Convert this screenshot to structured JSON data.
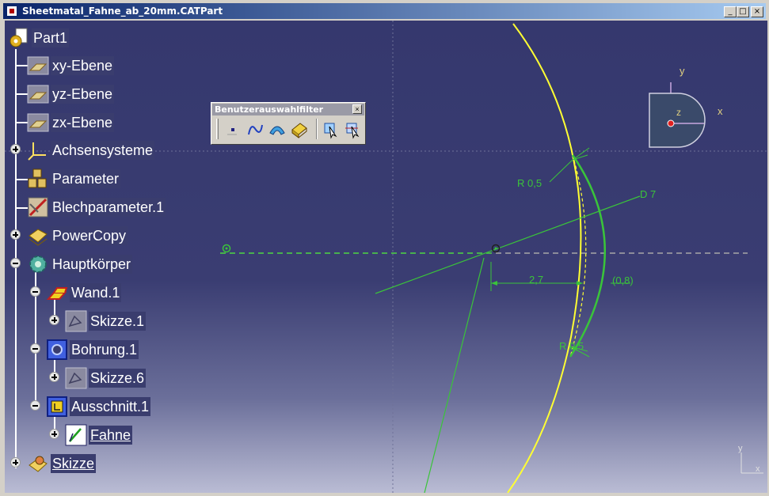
{
  "window": {
    "title": "Sheetmatal_Fahne_ab_20mm.CATPart",
    "buttons": {
      "minimize": "_",
      "maximize": "□",
      "close": "×"
    }
  },
  "tree": {
    "root": "Part1",
    "items": [
      {
        "label": "xy-Ebene",
        "icon": "plane-icon"
      },
      {
        "label": "yz-Ebene",
        "icon": "plane-icon"
      },
      {
        "label": "zx-Ebene",
        "icon": "plane-icon"
      },
      {
        "label": "Achsensysteme",
        "icon": "axis-system-icon",
        "expand": "plus"
      },
      {
        "label": "Parameter",
        "icon": "parameter-icon"
      },
      {
        "label": "Blechparameter.1",
        "icon": "sheetmetal-parameter-icon"
      },
      {
        "label": "PowerCopy",
        "icon": "powercopy-icon",
        "expand": "plus"
      },
      {
        "label": "Hauptkörper",
        "icon": "part-body-icon",
        "expand": "minus"
      },
      {
        "label": "Wand.1",
        "icon": "wall-icon",
        "expand": "minus"
      },
      {
        "label": "Skizze.1",
        "icon": "sketch-icon",
        "expand": "plus"
      },
      {
        "label": "Bohrung.1",
        "icon": "hole-icon",
        "expand": "minus"
      },
      {
        "label": "Skizze.6",
        "icon": "sketch-icon",
        "expand": "plus"
      },
      {
        "label": "Ausschnitt.1",
        "icon": "cutout-icon",
        "expand": "minus"
      },
      {
        "label": "Fahne",
        "icon": "active-sketch-icon",
        "expand": "plus",
        "underline": true
      },
      {
        "label": "Skizze",
        "icon": "sketch-body-icon",
        "expand": "plus",
        "underline": true
      }
    ]
  },
  "toolbar": {
    "title": "Benutzerauswahlfilter",
    "close": "×",
    "buttons": [
      "point-filter-icon",
      "curve-filter-icon",
      "surface-filter-icon",
      "volume-filter-icon",
      "feature-element-filter-icon",
      "intersection-edge-filter-icon"
    ]
  },
  "sketch": {
    "dimensions": {
      "r_top": "R 0,5",
      "diameter": "D 7",
      "horizontal": "2,7",
      "reference": "(0,8)",
      "r_bottom": "R 0,5"
    },
    "compass": {
      "x": "x",
      "y": "y",
      "z": "z"
    },
    "axis_corner": {
      "y": "y",
      "x": "x"
    },
    "colors": {
      "geometry": "#3ac43a",
      "edge": "#ffff33",
      "axis": "#a7a7a7",
      "compass_face": "#3a4a6a"
    }
  }
}
